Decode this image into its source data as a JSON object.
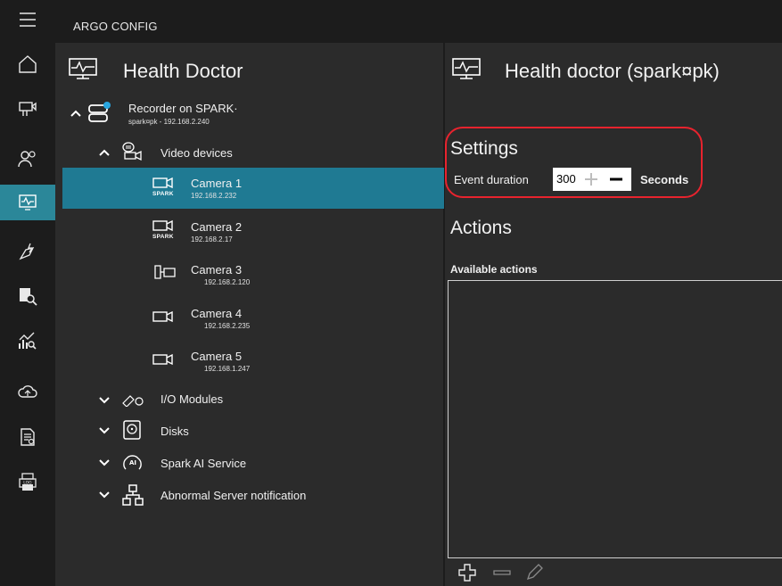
{
  "app": {
    "title": "ARGO CONFIG"
  },
  "left_panel": {
    "title": "Health Doctor"
  },
  "right_panel": {
    "title": "Health doctor (spark¤pk)"
  },
  "tree": {
    "recorder": {
      "title": "Recorder on SPARK·",
      "subtitle": "spark¤pk - 192.168.2.240"
    },
    "video_devices": {
      "label": "Video devices"
    },
    "cameras": [
      {
        "name": "Camera 1",
        "ip": "192.168.2.232",
        "tag": "SPARK",
        "icon": "spark-camera-icon"
      },
      {
        "name": "Camera 2",
        "ip": "192.168.2.17",
        "tag": "SPARK",
        "icon": "spark-camera-icon"
      },
      {
        "name": "Camera 3",
        "ip": "192.168.2.120",
        "tag": "",
        "icon": "bullet-camera-icon"
      },
      {
        "name": "Camera 4",
        "ip": "192.168.2.235",
        "tag": "",
        "icon": "box-camera-icon"
      },
      {
        "name": "Camera 5",
        "ip": "192.168.1.247",
        "tag": "",
        "icon": "box-camera-icon"
      }
    ],
    "groups": [
      {
        "label": "I/O Modules",
        "icon": "io-module-icon"
      },
      {
        "label": "Disks",
        "icon": "disk-icon"
      },
      {
        "label": "Spark AI Service",
        "icon": "ai-service-icon"
      },
      {
        "label": "Abnormal Server notification",
        "icon": "network-icon"
      }
    ]
  },
  "settings": {
    "heading": "Settings",
    "event_duration_label": "Event duration",
    "event_duration_value": "300",
    "unit_label": "Seconds"
  },
  "actions": {
    "heading": "Actions",
    "available_label": "Available actions"
  },
  "rail_icons": [
    "hamburger-menu-icon",
    "home-icon",
    "devices-icon",
    "users-icon",
    "health-doctor-icon",
    "alarm-icon",
    "search-person-icon",
    "analytics-icon",
    "cloud-icon",
    "report-icon",
    "log-printer-icon"
  ],
  "colors": {
    "accent": "#1f7a93",
    "rail_active": "#2b8799",
    "highlight": "#e8232e",
    "background": "#2b2b2b",
    "bar": "#1c1c1c"
  }
}
